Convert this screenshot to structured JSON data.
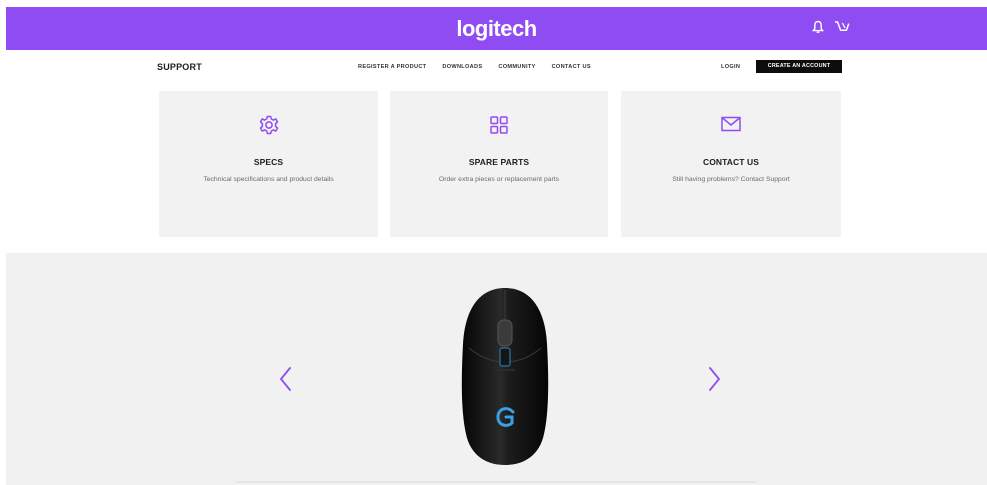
{
  "header": {
    "logo": "logitech",
    "brand_color": "#8f4cf2",
    "icons": [
      "user-icon",
      "cart-icon"
    ]
  },
  "nav": {
    "section": "SUPPORT",
    "links": [
      "REGISTER A PRODUCT",
      "DOWNLOADS",
      "COMMUNITY",
      "CONTACT US"
    ],
    "login": "LOGIN",
    "create_account": "CREATE AN ACCOUNT"
  },
  "cards": [
    {
      "icon": "gear-icon",
      "title": "SPECS",
      "description": "Technical specifications and product details"
    },
    {
      "icon": "grid-icon",
      "title": "SPARE PARTS",
      "description": "Order extra pieces or replacement parts"
    },
    {
      "icon": "mail-icon",
      "title": "CONTACT US",
      "description": "Still having problems? Contact Support"
    }
  ],
  "carousel": {
    "previous_icon": "chevron-left-icon",
    "next_icon": "chevron-right-icon",
    "product_image": "gaming-mouse"
  }
}
